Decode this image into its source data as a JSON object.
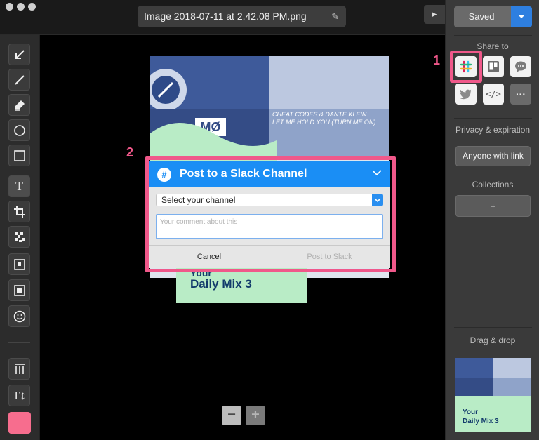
{
  "titlebar": {
    "filename": "Image 2018-07-11 at 2.42.08 PM.png"
  },
  "toolbar": {
    "tools": [
      {
        "name": "arrow-tool"
      },
      {
        "name": "line-tool"
      },
      {
        "name": "highlighter-tool"
      },
      {
        "name": "ellipse-tool"
      },
      {
        "name": "rectangle-tool"
      },
      {
        "name": "text-tool"
      },
      {
        "name": "crop-tool"
      },
      {
        "name": "pixelate-tool"
      },
      {
        "name": "spotlight-tool"
      },
      {
        "name": "frame-tool"
      },
      {
        "name": "emoji-tool"
      },
      {
        "name": "spacing-tool"
      },
      {
        "name": "text-size-tool"
      }
    ],
    "text_tool_glyph": "T",
    "text_size_glyph": "T↕",
    "current_color": "#f76d8e"
  },
  "canvas": {
    "text_artwork": "CHEAT CODES & DANTE KLEIN",
    "text_artwork_2": "LET ME HOLD YOU (TURN ME ON)",
    "card_line1": "Your",
    "card_line2": "Daily Mix 3"
  },
  "dialog": {
    "title": "Post to a Slack Channel",
    "select_value": "Select your channel",
    "comment_placeholder": "Your comment about this",
    "cancel_label": "Cancel",
    "post_label": "Post to Slack"
  },
  "zoom": {
    "minus": "−",
    "plus": "+"
  },
  "markers": {
    "one": "1",
    "two": "2"
  },
  "rightpanel": {
    "saved_label": "Saved",
    "share_to": "Share to",
    "privacy_label": "Privacy & expiration",
    "anyone_label": "Anyone with link",
    "collections_label": "Collections",
    "add_label": "+",
    "drag_drop_label": "Drag & drop",
    "thumb_line1": "Your",
    "thumb_line2": "Daily Mix 3",
    "embed_glyph": "</>",
    "more_glyph": "···"
  },
  "colors": {
    "accent": "#1a8ef5",
    "highlight": "#f0588a",
    "card_green": "#b9ecc6"
  }
}
